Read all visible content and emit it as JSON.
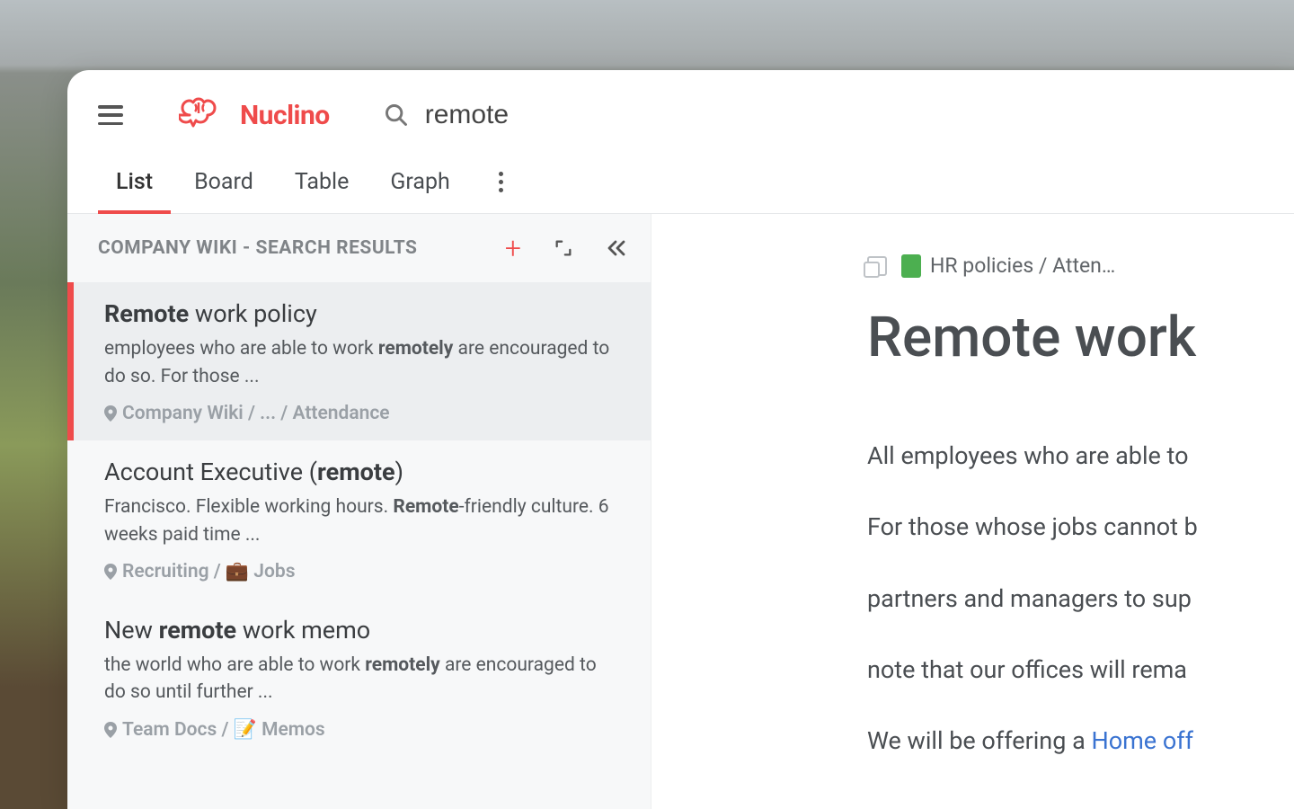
{
  "app": {
    "name": "Nuclino"
  },
  "search": {
    "value": "remote"
  },
  "tabs": [
    "List",
    "Board",
    "Table",
    "Graph"
  ],
  "activeTab": 0,
  "sidebar": {
    "title": "COMPANY WIKI - SEARCH RESULTS"
  },
  "results": [
    {
      "title_pre": "Remote",
      "title_post": " work policy",
      "snippet_pre": "employees who are able to work ",
      "snippet_bold": "remotely",
      "snippet_post": " are encouraged to do so. For those ...",
      "path": "Company Wiki / ... / Attendance",
      "path_emoji": ""
    },
    {
      "title_pre_plain": "Account Executive (",
      "title_bold": "remote",
      "title_post_plain": ")",
      "snippet_pre": "Francisco. Flexible working hours. ",
      "snippet_bold": "Remote",
      "snippet_post": "-friendly culture. 6 weeks paid time ...",
      "path": "Recruiting / 💼 Jobs"
    },
    {
      "title_pre_plain": "New ",
      "title_bold": "remote",
      "title_post_plain": " work memo",
      "snippet_pre": "the world who are able to work ",
      "snippet_bold": "remotely",
      "snippet_post": " are encouraged to do so until further ...",
      "path": "Team Docs / 📝 Memos"
    }
  ],
  "document": {
    "breadcrumb": "HR policies / Atten…",
    "title": "Remote work",
    "p1": "All employees who are able to",
    "p2": "For those whose jobs cannot b",
    "p3": "partners and managers to sup",
    "p4": "note that our offices will rema",
    "p5a": "We will be offering a ",
    "p5b": "Home off"
  }
}
